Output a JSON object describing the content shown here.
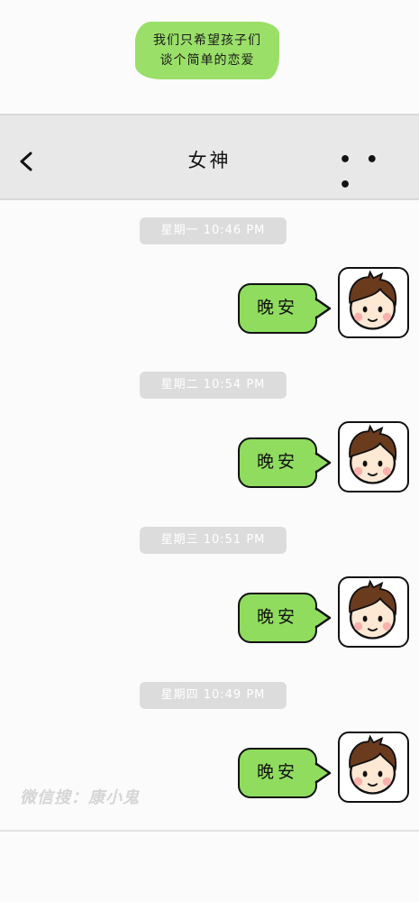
{
  "banner": {
    "line1": "我们只希望孩子们",
    "line2": "谈个简单的恋爱"
  },
  "header": {
    "title": "女神",
    "more_label": "• • •"
  },
  "messages": [
    {
      "time": "星期一 10:46 PM",
      "text": "晚安"
    },
    {
      "time": "星期二 10:54 PM",
      "text": "晚安"
    },
    {
      "time": "星期三 10:51 PM",
      "text": "晚安"
    },
    {
      "time": "星期四 10:49 PM",
      "text": "晚安"
    }
  ],
  "watermark": "微信搜：康小鬼",
  "colors": {
    "bubble": "#8fdc5f",
    "banner": "#9adf68",
    "navbar": "#e8e8e8",
    "timestamp": "#dcdcdc"
  }
}
